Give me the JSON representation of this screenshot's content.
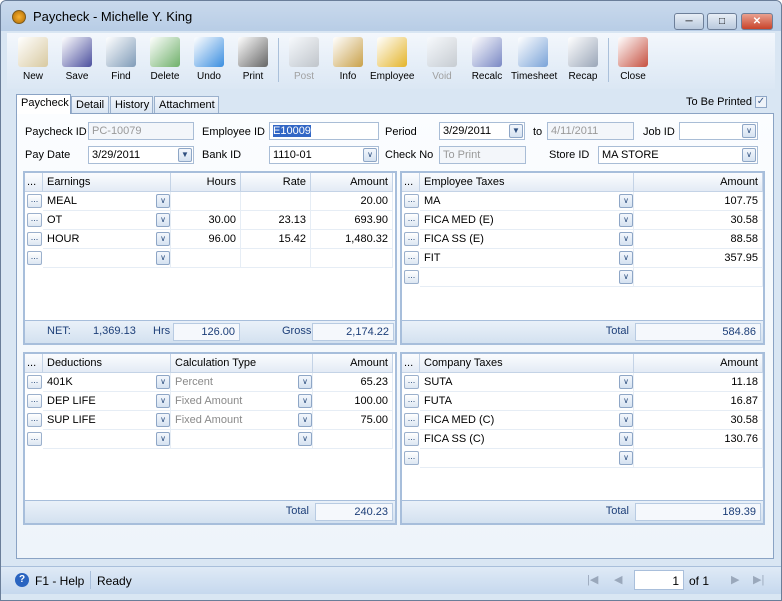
{
  "window": {
    "title": "Paycheck - Michelle Y. King"
  },
  "toolbar": [
    {
      "label": "New",
      "icon": "new-icon",
      "enabled": true
    },
    {
      "label": "Save",
      "icon": "save-icon",
      "enabled": true
    },
    {
      "label": "Find",
      "icon": "find-icon",
      "enabled": true
    },
    {
      "label": "Delete",
      "icon": "delete-icon",
      "enabled": true
    },
    {
      "label": "Undo",
      "icon": "undo-icon",
      "enabled": true
    },
    {
      "label": "Print",
      "icon": "print-icon",
      "enabled": true
    },
    {
      "label": "Post",
      "icon": "post-icon",
      "enabled": false
    },
    {
      "label": "Info",
      "icon": "info-icon",
      "enabled": true
    },
    {
      "label": "Employee",
      "icon": "employee-icon",
      "enabled": true
    },
    {
      "label": "Void",
      "icon": "void-icon",
      "enabled": false
    },
    {
      "label": "Recalc",
      "icon": "recalc-icon",
      "enabled": true
    },
    {
      "label": "Timesheet",
      "icon": "timesheet-icon",
      "enabled": true
    },
    {
      "label": "Recap",
      "icon": "recap-icon",
      "enabled": true
    },
    {
      "label": "Close",
      "icon": "close-icon",
      "enabled": true
    }
  ],
  "tabs": [
    "Paycheck",
    "Detail",
    "History",
    "Attachment"
  ],
  "to_be_printed": {
    "label": "To Be Printed",
    "checked": true
  },
  "form": {
    "paycheck_id_label": "Paycheck ID",
    "paycheck_id": "PC-10079",
    "employee_id_label": "Employee ID",
    "employee_id": "E10009",
    "period_label": "Period",
    "period_from": "3/29/2011",
    "to_label": "to",
    "period_to": "4/11/2011",
    "job_id_label": "Job ID",
    "job_id": "",
    "pay_date_label": "Pay Date",
    "pay_date": "3/29/2011",
    "bank_id_label": "Bank ID",
    "bank_id": "1110-01",
    "check_no_label": "Check No",
    "check_no_placeholder": "To Print",
    "store_id_label": "Store ID",
    "store_id": "MA STORE"
  },
  "earnings": {
    "headers": [
      "Earnings",
      "Hours",
      "Rate",
      "Amount"
    ],
    "rows": [
      [
        "MEAL",
        "",
        "",
        "20.00"
      ],
      [
        "OT",
        "30.00",
        "23.13",
        "693.90"
      ],
      [
        "HOUR",
        "96.00",
        "15.42",
        "1,480.32"
      ],
      [
        "",
        "",
        "",
        ""
      ]
    ],
    "net_label": "NET:",
    "net": "1,369.13",
    "hrs_label": "Hrs",
    "hrs": "126.00",
    "gross_label": "Gross",
    "gross": "2,174.22"
  },
  "employee_taxes": {
    "headers": [
      "Employee Taxes",
      "Amount"
    ],
    "rows": [
      [
        "MA",
        "107.75"
      ],
      [
        "FICA MED (E)",
        "30.58"
      ],
      [
        "FICA SS (E)",
        "88.58"
      ],
      [
        "FIT",
        "357.95"
      ],
      [
        "",
        ""
      ]
    ],
    "total_label": "Total",
    "total": "584.86"
  },
  "deductions": {
    "headers": [
      "Deductions",
      "Calculation Type",
      "Amount"
    ],
    "rows": [
      [
        "401K",
        "Percent",
        "65.23"
      ],
      [
        "DEP LIFE",
        "Fixed Amount",
        "100.00"
      ],
      [
        "SUP LIFE",
        "Fixed Amount",
        "75.00"
      ],
      [
        "",
        "",
        ""
      ]
    ],
    "total_label": "Total",
    "total": "240.23"
  },
  "company_taxes": {
    "headers": [
      "Company Taxes",
      "Amount"
    ],
    "rows": [
      [
        "SUTA",
        "11.18"
      ],
      [
        "FUTA",
        "16.87"
      ],
      [
        "FICA MED (C)",
        "30.58"
      ],
      [
        "FICA SS (C)",
        "130.76"
      ],
      [
        "",
        ""
      ]
    ],
    "total_label": "Total",
    "total": "189.39"
  },
  "status": {
    "help": "F1 - Help",
    "state": "Ready",
    "page": "1",
    "of_label": "of 1"
  }
}
